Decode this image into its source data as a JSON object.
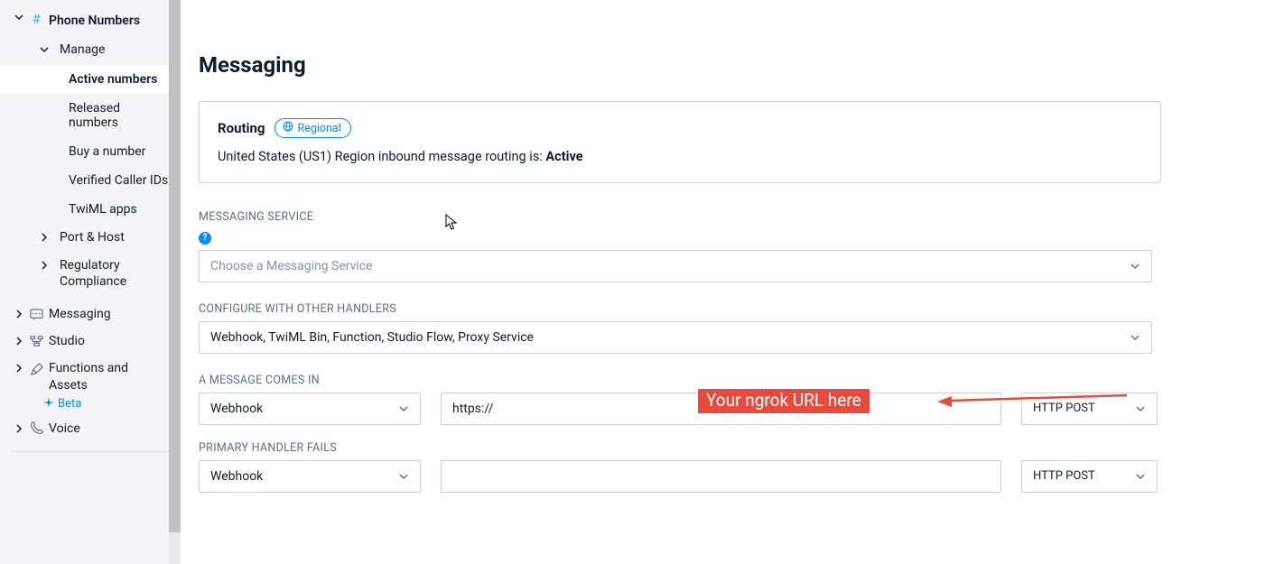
{
  "sidebar": {
    "phone_numbers": "Phone Numbers",
    "manage": "Manage",
    "active_numbers": "Active numbers",
    "released_numbers": "Released numbers",
    "buy_a_number": "Buy a number",
    "verified_caller_ids": "Verified Caller IDs",
    "twiml_apps": "TwiML apps",
    "port_host": "Port & Host",
    "regulatory_compliance": "Regulatory Compliance",
    "messaging": "Messaging",
    "studio": "Studio",
    "functions_assets": "Functions and Assets",
    "beta": "Beta",
    "voice": "Voice"
  },
  "main": {
    "title": "Messaging",
    "routing": {
      "title": "Routing",
      "pill": "Regional",
      "status_prefix": "United States (US1) Region inbound message routing is: ",
      "status_value": "Active"
    },
    "messaging_service": {
      "label": "MESSAGING SERVICE",
      "placeholder": "Choose a Messaging Service"
    },
    "configure_with": {
      "label": "CONFIGURE WITH OTHER HANDLERS",
      "value": "Webhook, TwiML Bin, Function, Studio Flow, Proxy Service"
    },
    "message_comes_in": {
      "label": "A MESSAGE COMES IN",
      "type": "Webhook",
      "url_prefix": "https://",
      "method": "HTTP POST"
    },
    "primary_fails": {
      "label": "PRIMARY HANDLER FAILS",
      "type": "Webhook",
      "url": "",
      "method": "HTTP POST"
    },
    "annotation": "Your ngrok URL here"
  }
}
